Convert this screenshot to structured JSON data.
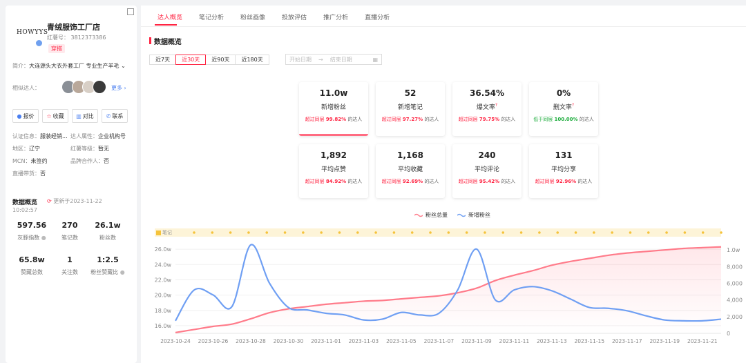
{
  "profile": {
    "logo_text": "HOWYYS",
    "name": "青绒服饰工厂店",
    "red_id": "红薯号： 3812373386",
    "tag": "穿搭",
    "intro_label": "简介：",
    "intro": "大连源头大衣外套工厂 专业生产羊毛",
    "similar_label": "相似达人：",
    "more": "更多",
    "buttons": [
      "报价",
      "收藏",
      "对比",
      "联系"
    ],
    "info": [
      {
        "label": "认证信息：",
        "value": "服装经销..."
      },
      {
        "label": "达人属性：",
        "value": "企业机构号"
      },
      {
        "label": "地区：",
        "value": "辽宁"
      },
      {
        "label": "红薯等级：",
        "value": "暂无"
      },
      {
        "label": "MCN：",
        "value": "未签约"
      },
      {
        "label": "品牌合作人：",
        "value": "否"
      },
      {
        "label": "直播带货：",
        "value": "否"
      }
    ],
    "overview_title": "数据概览",
    "updated": "更新于2023-11-22",
    "updated_time": "10:02:57",
    "stats": [
      {
        "value": "597.56",
        "label": "灰豚指数"
      },
      {
        "value": "270",
        "label": "笔记数"
      },
      {
        "value": "26.1w",
        "label": "粉丝数"
      },
      {
        "value": "65.8w",
        "label": "赞藏总数"
      },
      {
        "value": "1",
        "label": "关注数"
      },
      {
        "value": "1:2.5",
        "label": "粉丝赞藏比"
      }
    ]
  },
  "tabs": [
    "达人概览",
    "笔记分析",
    "粉丝画像",
    "投放评估",
    "推广分析",
    "直播分析"
  ],
  "section_title": "数据概览",
  "ranges": [
    "近7天",
    "近30天",
    "近90天",
    "近180天"
  ],
  "date_start": "开始日期",
  "date_end": "结束日期",
  "cards": [
    {
      "value": "11.0w",
      "label": "新增粉丝",
      "pre": "超过同层",
      "pct": "99.82%",
      "post": "的达人"
    },
    {
      "value": "52",
      "label": "新增笔记",
      "pre": "超过同层",
      "pct": "97.27%",
      "post": "的达人"
    },
    {
      "value": "36.54%",
      "label": "爆文率",
      "pre": "超过同层",
      "pct": "79.75%",
      "post": "的达人"
    },
    {
      "value": "0%",
      "label": "删文率",
      "pre": "低于同层",
      "pct": "100.00%",
      "post": "的达人"
    },
    {
      "value": "1,892",
      "label": "平均点赞",
      "pre": "超过同层",
      "pct": "84.92%",
      "post": "的达人"
    },
    {
      "value": "1,168",
      "label": "平均收藏",
      "pre": "超过同层",
      "pct": "92.69%",
      "post": "的达人"
    },
    {
      "value": "240",
      "label": "平均评论",
      "pre": "超过同层",
      "pct": "95.42%",
      "post": "的达人"
    },
    {
      "value": "131",
      "label": "平均分享",
      "pre": "超过同层",
      "pct": "92.96%",
      "post": "的达人"
    }
  ],
  "card_help": "?",
  "colors": {
    "accent": "#ff2442",
    "total_line": "#ff7b8a",
    "new_line": "#6f9ff3",
    "green": "#1aab3a"
  },
  "chart_data": {
    "type": "line",
    "legend": [
      "粉丝总量",
      "新增粉丝"
    ],
    "note_label": "笔记",
    "x_ticks": [
      "2023-10-24",
      "2023-10-26",
      "2023-10-28",
      "2023-10-30",
      "2023-11-01",
      "2023-11-03",
      "2023-11-05",
      "2023-11-07",
      "2023-11-09",
      "2023-11-11",
      "2023-11-13",
      "2023-11-15",
      "2023-11-17",
      "2023-11-19",
      "2023-11-21"
    ],
    "left_ticks": [
      "16.0w",
      "18.0w",
      "20.0w",
      "22.0w",
      "24.0w",
      "26.0w"
    ],
    "right_ticks": [
      "0",
      "2,000",
      "4,000",
      "6,000",
      "8,000",
      "1.0w"
    ],
    "left_ylim": [
      15.0,
      27.0
    ],
    "right_ylim": [
      0,
      11000
    ],
    "dates": [
      "10-24",
      "10-25",
      "10-26",
      "10-27",
      "10-28",
      "10-29",
      "10-30",
      "10-31",
      "11-01",
      "11-02",
      "11-03",
      "11-04",
      "11-05",
      "11-06",
      "11-07",
      "11-08",
      "11-09",
      "11-10",
      "11-11",
      "11-12",
      "11-13",
      "11-14",
      "11-15",
      "11-16",
      "11-17",
      "11-18",
      "11-19",
      "11-20",
      "11-21",
      "11-22"
    ],
    "series": [
      {
        "name": "粉丝总量",
        "axis": "left",
        "values": [
          15.1,
          15.5,
          15.9,
          16.2,
          16.9,
          17.7,
          18.2,
          18.5,
          18.8,
          19.0,
          19.2,
          19.3,
          19.5,
          19.7,
          19.9,
          20.3,
          20.9,
          21.9,
          22.6,
          23.2,
          23.9,
          24.4,
          24.8,
          25.2,
          25.5,
          25.7,
          25.9,
          26.1,
          26.2,
          26.3
        ]
      },
      {
        "name": "新增粉丝",
        "axis": "right",
        "values": [
          1500,
          5200,
          4600,
          3200,
          10600,
          6000,
          3100,
          2800,
          2400,
          2200,
          1600,
          1700,
          2500,
          2200,
          2400,
          5200,
          10100,
          4000,
          5200,
          5600,
          5100,
          4100,
          3100,
          3000,
          2700,
          2100,
          1600,
          1500,
          1500,
          1700
        ]
      }
    ],
    "note_markers": 30
  }
}
